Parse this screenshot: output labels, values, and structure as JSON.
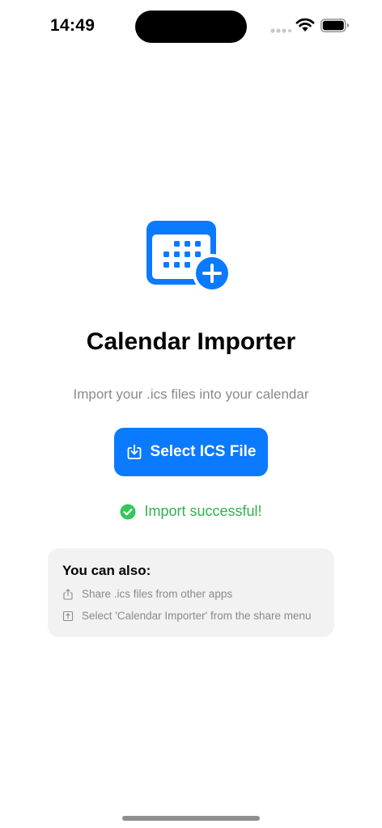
{
  "status_bar": {
    "time": "14:49",
    "icons": [
      "cellular-signal-icon",
      "wifi-icon",
      "battery-icon"
    ]
  },
  "app": {
    "icon": "calendar-add-icon",
    "title": "Calendar Importer",
    "subtitle": "Import your .ics files into your calendar",
    "accent_color": "#0a7aff",
    "success_color": "#2fb24c"
  },
  "select_button": {
    "label": "Select ICS File",
    "icon": "import-file-icon"
  },
  "import_status": {
    "icon": "checkmark-circle-icon",
    "text": "Import successful!"
  },
  "tips": {
    "title": "You can also:",
    "items": [
      {
        "icon": "share-icon",
        "text": "Share .ics files from other apps"
      },
      {
        "icon": "share-menu-icon",
        "text": "Select 'Calendar Importer' from the share menu"
      }
    ]
  }
}
